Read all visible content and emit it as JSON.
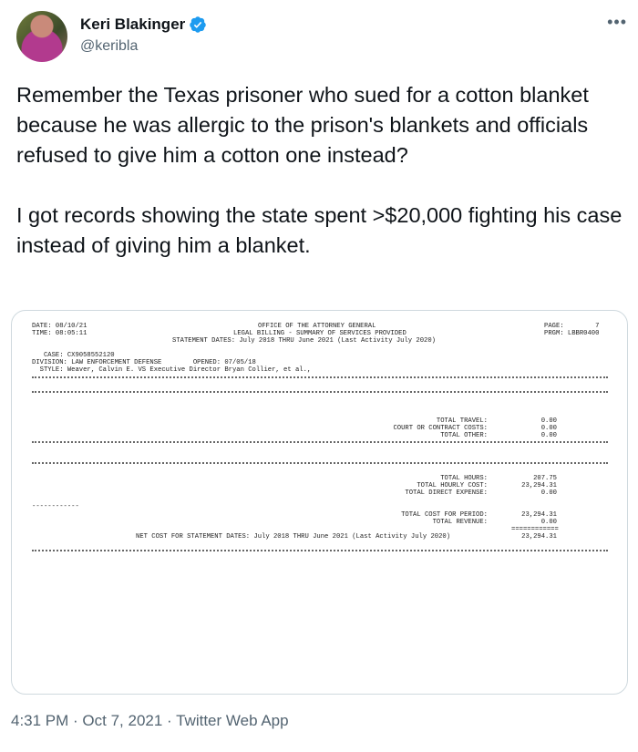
{
  "author": {
    "name": "Keri Blakinger",
    "handle": "@keribla",
    "verified": true
  },
  "more_icon": "more-dots-icon",
  "tweet": {
    "paragraphs": [
      "Remember the Texas prisoner who sued for a cotton blanket because he was allergic to the prison's blankets and officials refused to give him a cotton one instead?",
      "I got records showing the state spent >$20,000 fighting his case instead of giving him a blanket."
    ]
  },
  "document": {
    "date": "DATE: 08/10/21",
    "time": "TIME: 08:05:11",
    "office": "OFFICE OF THE ATTORNEY GENERAL",
    "billing": "LEGAL BILLING - SUMMARY OF SERVICES PROVIDED",
    "statement_dates": "STATEMENT DATES: July 2018 THRU June 2021 (Last Activity July 2020)",
    "page": "PAGE:        7",
    "prgm": "PRGM: LBBR0400",
    "case": "   CASE: CX9058552120",
    "division": "DIVISION: LAW ENFORCEMENT DEFENSE        OPENED: 07/05/18",
    "style": "  STYLE: Weaver, Calvin E. VS Executive Director Bryan Collier, et al.,",
    "labels_1": [
      "TOTAL TRAVEL:",
      "COURT OR CONTRACT COSTS:",
      "TOTAL OTHER:"
    ],
    "values_1": [
      "0.00",
      "0.00",
      "0.00"
    ],
    "labels_2": [
      "TOTAL HOURS:",
      "TOTAL HOURLY COST:",
      "TOTAL DIRECT EXPENSE:"
    ],
    "values_2": [
      "207.75",
      "23,294.31",
      "0.00"
    ],
    "dash_line": "------------",
    "labels_3": [
      "TOTAL COST FOR PERIOD:",
      "TOTAL REVENUE:"
    ],
    "values_3": [
      "23,294.31",
      "0.00"
    ],
    "equals_line": "============",
    "net_label": "NET COST FOR STATEMENT DATES: July 2018 THRU June 2021 (Last Activity July 2020)",
    "net_value": "23,294.31"
  },
  "footer": {
    "timestamp": "4:31 PM · Oct 7, 2021 · Twitter Web App"
  },
  "colors": {
    "verified_blue": "#1d9bf0",
    "secondary_text": "#536471",
    "border": "#cfd9de"
  }
}
